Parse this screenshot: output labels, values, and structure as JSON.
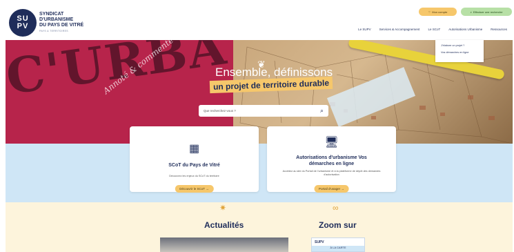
{
  "logo": {
    "mark_top": "SU",
    "mark_bottom": "PV",
    "line1": "SYNDICAT",
    "line2": "D'URBANISME",
    "line3": "DU PAYS DE VITRÉ",
    "tagline": "PAYS & TERRITOIRES"
  },
  "header": {
    "account_label": "Mon compte",
    "search_label": "Effectuer une recherche",
    "nav": [
      "Le SUPV",
      "Services & Accompagnement",
      "Le SCoT",
      "Autorisations Urbanisme",
      "Ressources"
    ],
    "dropdown": [
      "J'élabore un projet ?",
      "Vos démarches en ligne"
    ]
  },
  "hero": {
    "big_text": "C'URBA",
    "script_text": "Annoté & commenté",
    "title_line1": "Ensemble, définissons",
    "title_line2": "un projet de territoire durable",
    "search_placeholder": "Que recherchez-vous ?"
  },
  "cards": [
    {
      "title": "SCoT du Pays de Vitré",
      "desc": "Découvrez les enjeux du SCoT du territoire",
      "button": "Découvrir le SCoT"
    },
    {
      "title": "Autorisations d'urbanisme Vos démarches en ligne",
      "desc": "Accédez au site du Portail de l'urbanisme et à la plateforme de dépôt des demandes d'autorisation",
      "button": "Portail d'usager"
    }
  ],
  "sections": {
    "news_title": "Actualités",
    "zoom_title": "Zoom sur",
    "zoom_badge": "SUPV",
    "zoom_caption": "À LA CARTE"
  },
  "colors": {
    "navy": "#1f2d5a",
    "yellow": "#f6c76b",
    "green": "#b7e0a6",
    "blue_band": "#cfe6f6",
    "cream": "#fdf4dc",
    "hero_red": "#b7244b"
  }
}
